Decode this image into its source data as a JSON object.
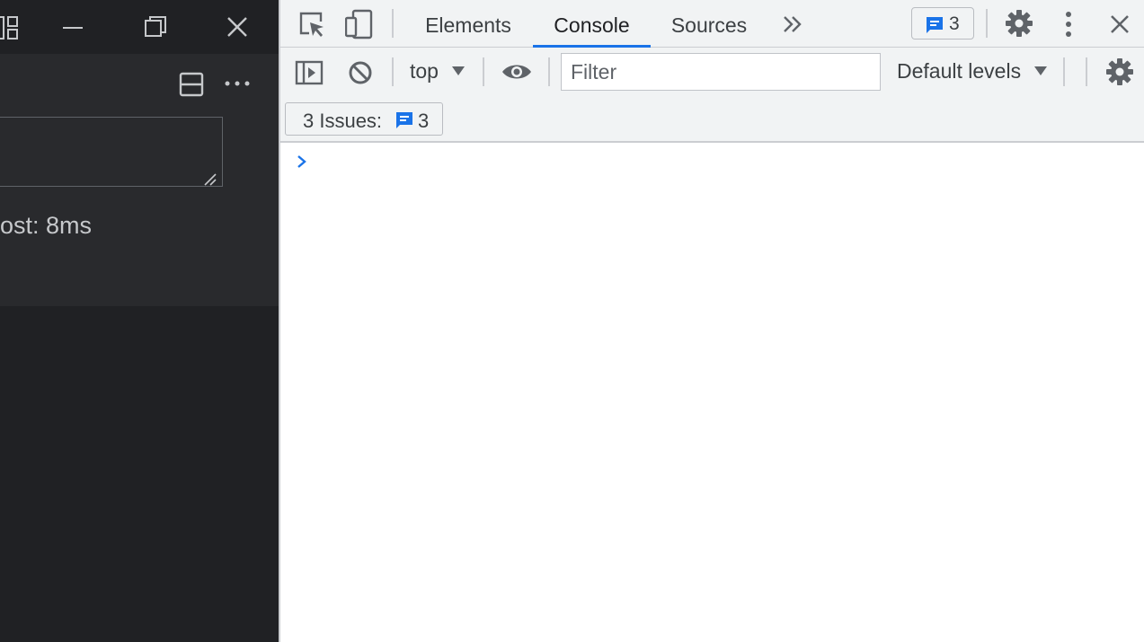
{
  "app": {
    "status_text": "ost: 8ms"
  },
  "devtools": {
    "tabs": [
      {
        "label": "Elements"
      },
      {
        "label": "Console",
        "active": true
      },
      {
        "label": "Sources"
      }
    ],
    "issues_count": "3",
    "toolbar": {
      "context": "top",
      "filter_placeholder": "Filter",
      "levels": "Default levels"
    },
    "issues_bar": {
      "label": "3 Issues:",
      "count": "3"
    }
  },
  "colors": {
    "accent": "#1a73e8",
    "dark_bg": "#202124",
    "panel_bg": "#f1f3f4"
  }
}
